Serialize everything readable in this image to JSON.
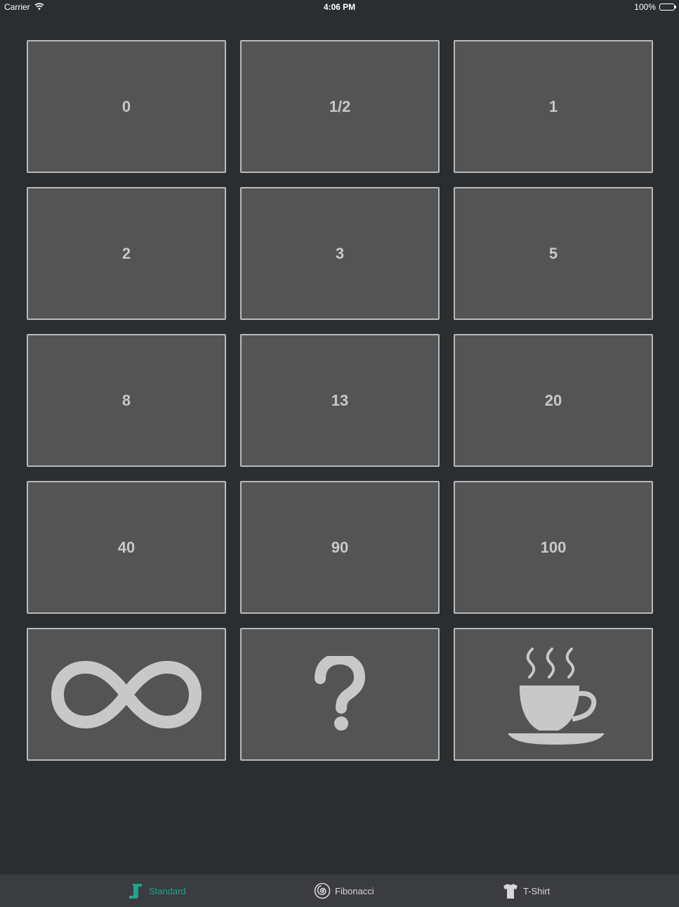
{
  "status_bar": {
    "carrier": "Carrier",
    "time": "4:06 PM",
    "battery": "100%"
  },
  "cards": [
    {
      "label": "0"
    },
    {
      "label": "1/2"
    },
    {
      "label": "1"
    },
    {
      "label": "2"
    },
    {
      "label": "3"
    },
    {
      "label": "5"
    },
    {
      "label": "8"
    },
    {
      "label": "13"
    },
    {
      "label": "20"
    },
    {
      "label": "40"
    },
    {
      "label": "90"
    },
    {
      "label": "100"
    },
    {
      "icon": "infinity-icon"
    },
    {
      "icon": "question-mark-icon"
    },
    {
      "icon": "coffee-cup-icon"
    }
  ],
  "tabs": [
    {
      "label": "Standard",
      "icon": "standard-deck-icon",
      "active": true
    },
    {
      "label": "Fibonacci",
      "icon": "fibonacci-spiral-icon",
      "active": false
    },
    {
      "label": "T-Shirt",
      "icon": "t-shirt-icon",
      "active": false
    }
  ],
  "colors": {
    "background": "#2b2e31",
    "card": "#545454",
    "card_border": "#b9b9b9",
    "card_text": "#c8c8c8",
    "tab_bar": "#3a3c3f",
    "accent": "#1fa489"
  }
}
